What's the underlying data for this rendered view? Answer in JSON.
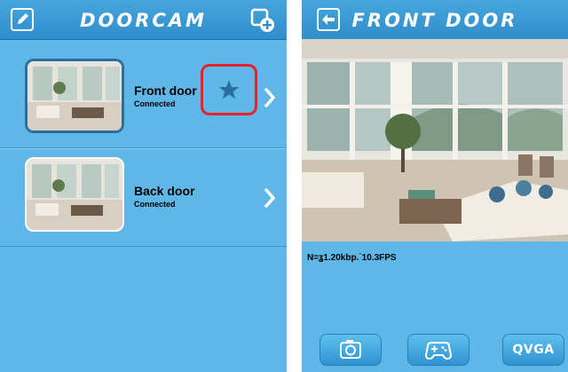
{
  "device_list": {
    "title": "DOORCAM",
    "devices": [
      {
        "name": "Front door",
        "status": "Connected",
        "selected": true,
        "favorite": true
      },
      {
        "name": "Back door",
        "status": "Connected",
        "selected": false,
        "favorite": false
      }
    ]
  },
  "live_view": {
    "title": "FRONT DOOR",
    "stream_stats": "N=ʓ1.20kbp.˙10.3FPS",
    "resolution_label": "QVGA"
  },
  "colors": {
    "panel": "#5eb7e6",
    "header": "#2f8ecb",
    "highlight": "#e8212b",
    "star": "#2b6f9e"
  },
  "icons": {
    "edit": "edit-icon",
    "add_camera": "add-camera-icon",
    "back": "back-icon",
    "favorite": "star-icon",
    "snapshot": "camera-icon",
    "ptz": "gamepad-icon"
  }
}
